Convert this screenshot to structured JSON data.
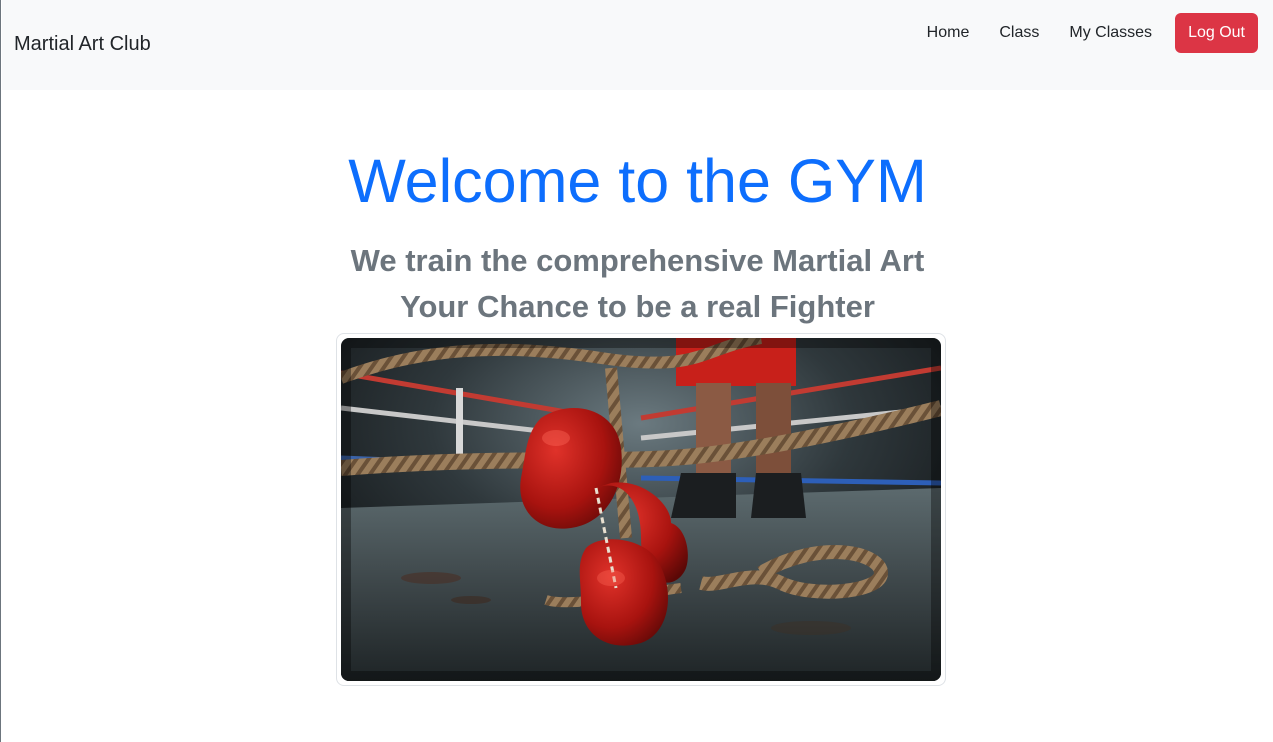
{
  "navbar": {
    "brand": "Martial Art Club",
    "links": [
      {
        "label": "Home"
      },
      {
        "label": "Class"
      },
      {
        "label": "My Classes"
      }
    ],
    "logout_label": "Log Out"
  },
  "hero": {
    "title": "Welcome to the GYM",
    "subtitle_line1": "We train the comprehensive Martial Art",
    "subtitle_line2": "Your Chance to be a real Fighter"
  },
  "image": {
    "description_icon": "boxing-gloves-ring-photo"
  },
  "colors": {
    "primary": "#0d6efd",
    "danger": "#dc3545",
    "muted": "#6c757d",
    "navbar_bg": "#f8f9fa"
  }
}
